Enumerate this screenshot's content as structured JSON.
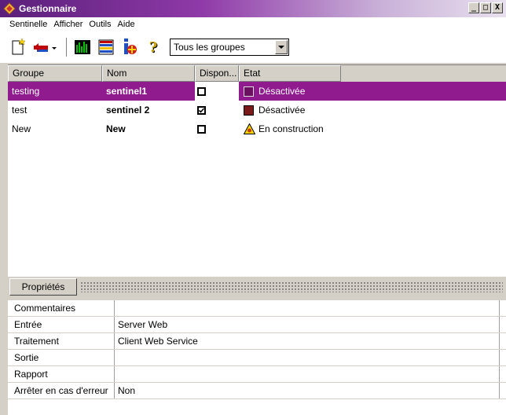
{
  "window": {
    "title": "Gestionnaire",
    "btn_min": "_",
    "btn_max": "□",
    "btn_close": "X"
  },
  "menu": [
    "Sentinelle",
    "Afficher",
    "Outils",
    "Aide"
  ],
  "toolbar": {
    "group_select_value": "Tous les groupes",
    "help_glyph": "?",
    "dropdown_arrow": "▾"
  },
  "grid": {
    "columns": [
      "Groupe",
      "Nom",
      "Dispon...",
      "Etat"
    ],
    "rows": [
      {
        "groupe": "testing",
        "nom": "sentinel1",
        "dispon": false,
        "etat": "Désactivée",
        "etat_icon": "status-swatch",
        "selected": true
      },
      {
        "groupe": "test",
        "nom": "sentinel 2",
        "dispon": true,
        "etat": "Désactivée",
        "etat_icon": "status-swatch",
        "selected": false
      },
      {
        "groupe": "New",
        "nom": "New",
        "dispon": false,
        "etat": "En construction",
        "etat_icon": "warning-icon",
        "selected": false
      }
    ]
  },
  "properties": {
    "tab_label": "Propriétés",
    "rows": [
      {
        "key": "Commentaires",
        "value": ""
      },
      {
        "key": "Entrée",
        "value": "Server Web"
      },
      {
        "key": "Traitement",
        "value": "Client Web Service"
      },
      {
        "key": "Sortie",
        "value": ""
      },
      {
        "key": "Rapport",
        "value": ""
      },
      {
        "key": "Arrêter en cas d'erreur",
        "value": "Non"
      }
    ]
  },
  "colors": {
    "title_bar": "#5a1f7a",
    "selection": "#8f1b8f",
    "status_swatch": "#7a1a1a"
  }
}
